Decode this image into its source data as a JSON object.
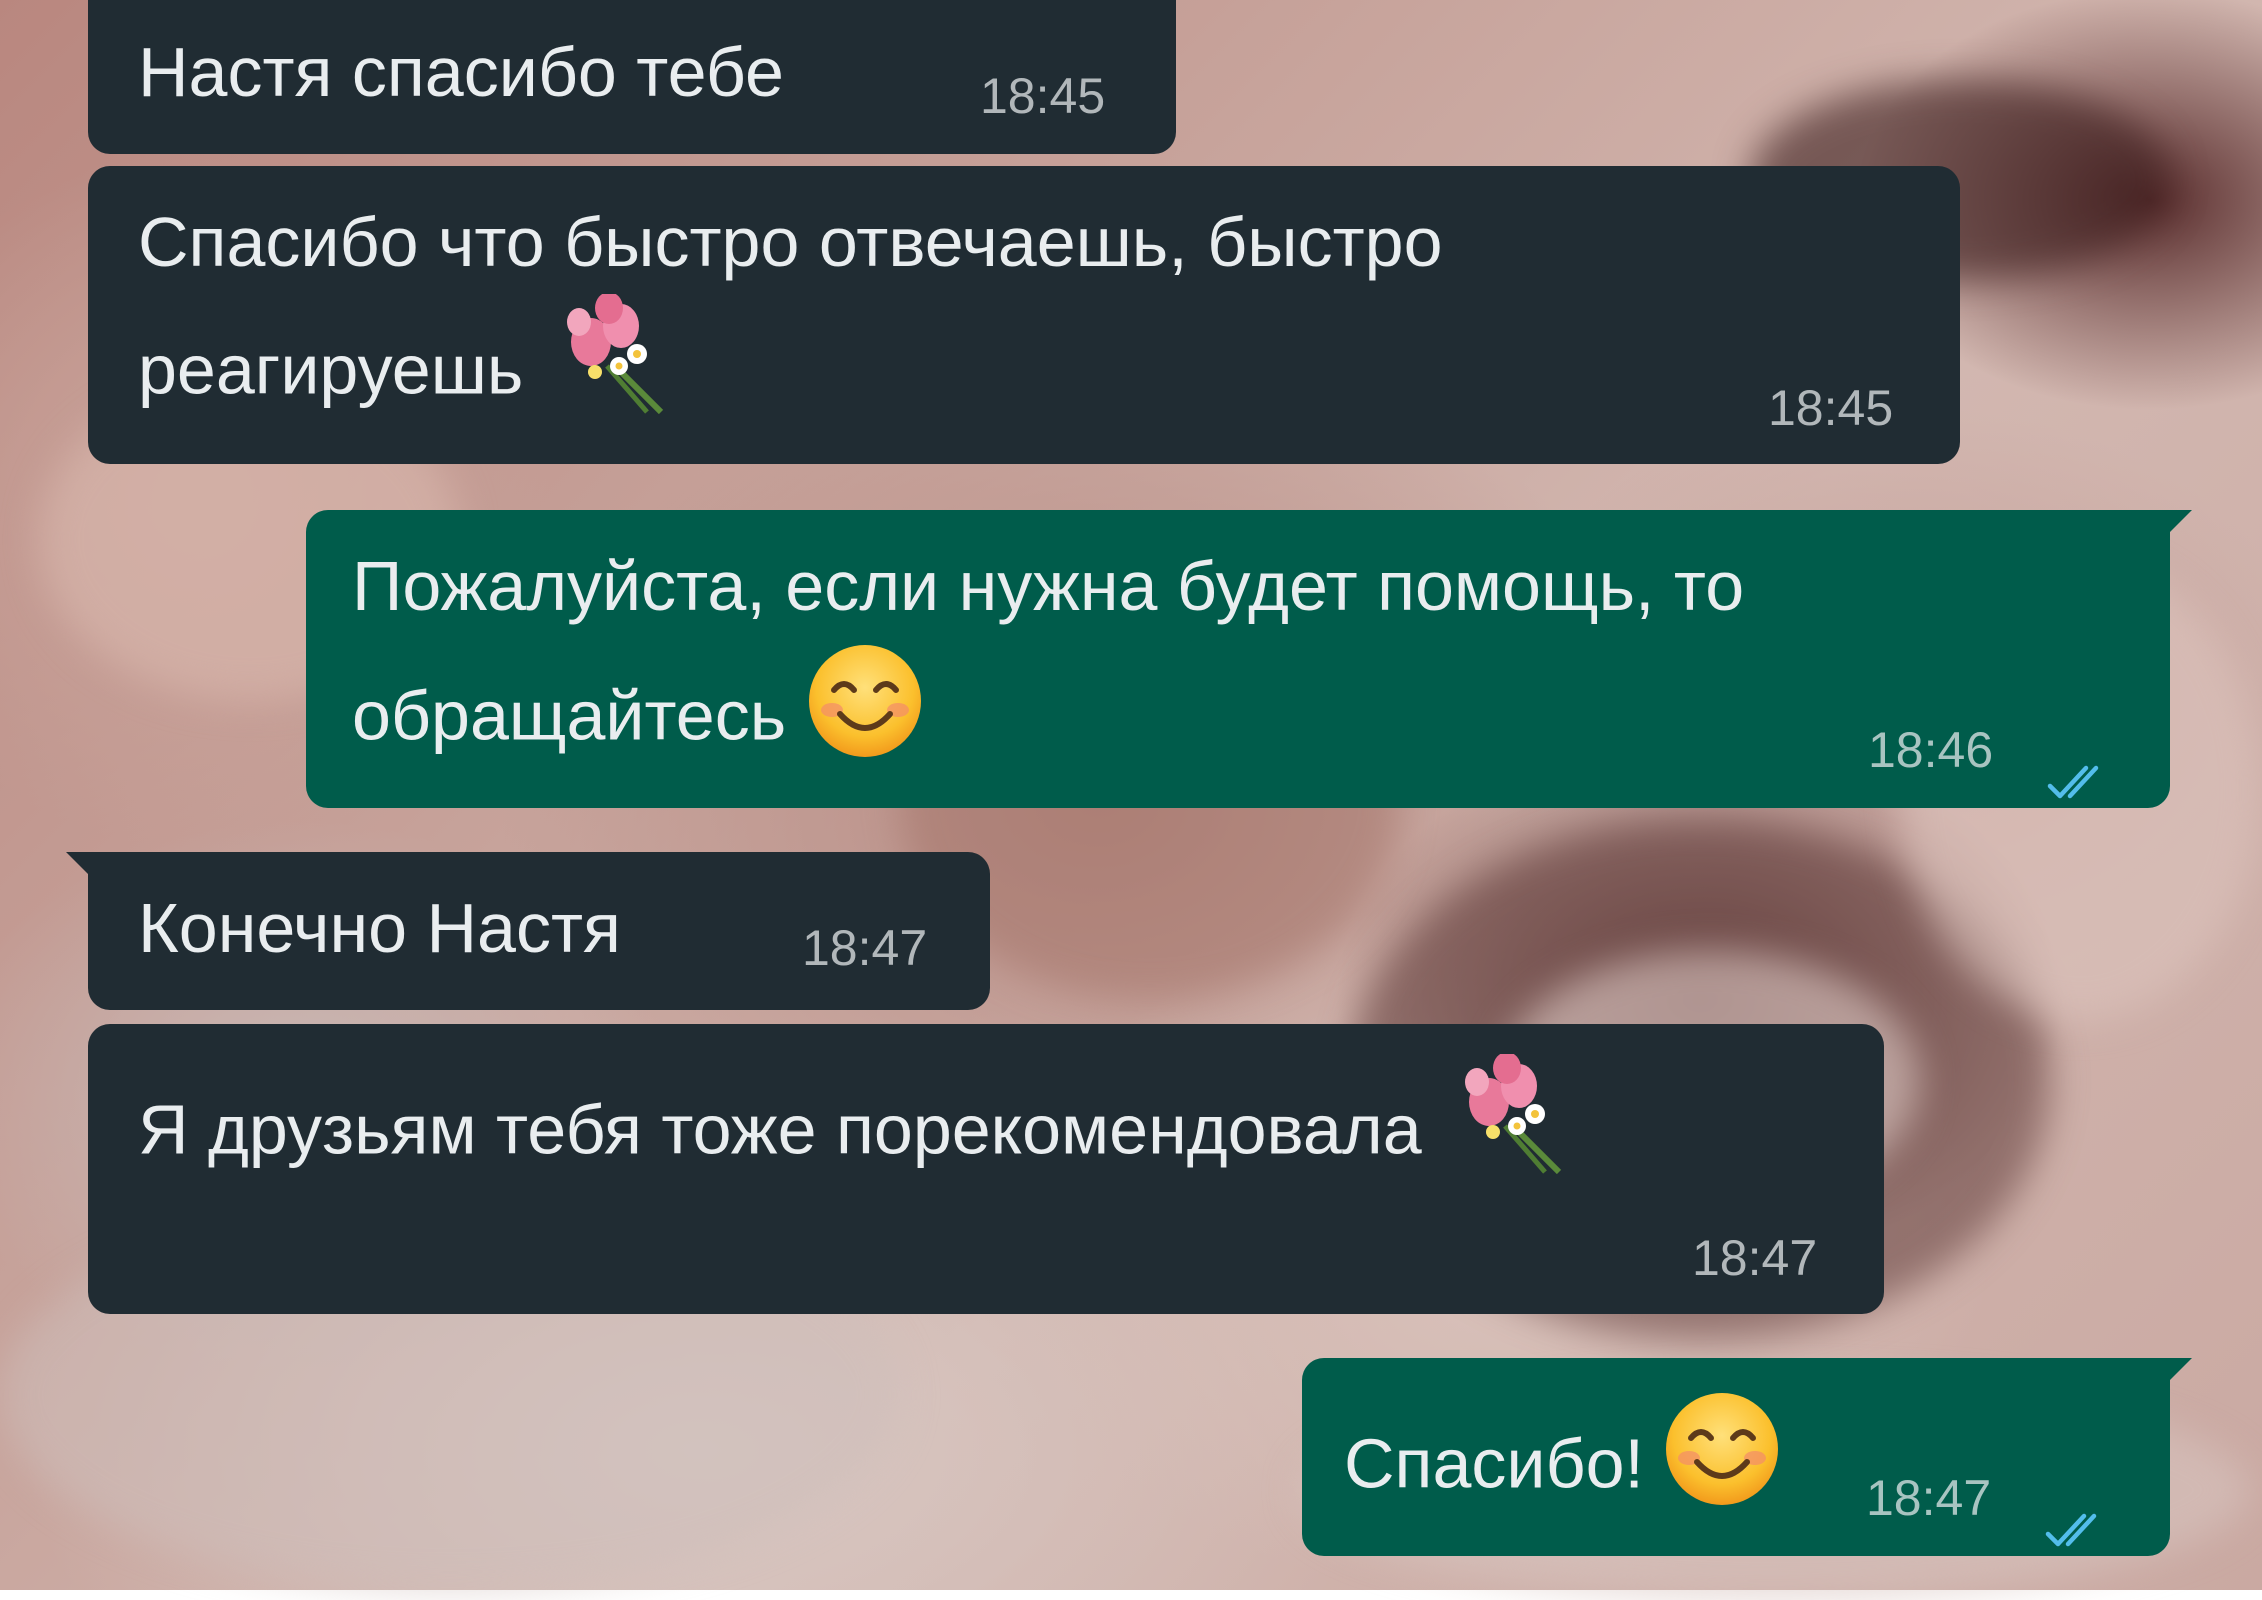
{
  "colors": {
    "incoming_bubble": "#202c33",
    "outgoing_bubble": "#005c4b",
    "text": "#e9edef",
    "read_ticks": "#53bdeb"
  },
  "messages": [
    {
      "direction": "incoming",
      "lines": [
        "Настя спасибо тебе"
      ],
      "time": "18:45",
      "emoji": null
    },
    {
      "direction": "incoming",
      "lines": [
        "Спасибо что быстро отвечаешь, быстро",
        "реагируешь"
      ],
      "time": "18:45",
      "emoji": "bouquet-icon"
    },
    {
      "direction": "outgoing",
      "lines": [
        "Пожалуйста, если нужна будет помощь, то",
        "обращайтесь"
      ],
      "time": "18:46",
      "emoji": "smiling-face-icon",
      "status": "read"
    },
    {
      "direction": "incoming",
      "lines": [
        "Конечно Настя"
      ],
      "time": "18:47",
      "emoji": null
    },
    {
      "direction": "incoming",
      "lines": [
        "Я друзьям тебя тоже порекомендовала"
      ],
      "time": "18:47",
      "emoji": "bouquet-icon"
    },
    {
      "direction": "outgoing",
      "lines": [
        "Спасибо!"
      ],
      "time": "18:47",
      "emoji": "smiling-face-icon",
      "status": "read"
    }
  ]
}
